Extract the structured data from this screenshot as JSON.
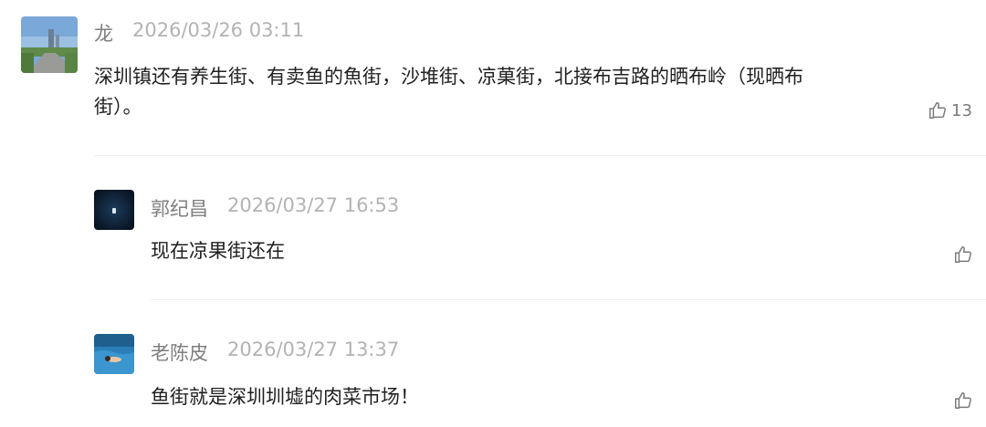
{
  "comments": [
    {
      "name": "龙",
      "time": "2026/03/26 03:11",
      "text": "深圳镇还有养生街、有卖鱼的魚街，沙堆街、凉菓街，北接布吉路的晒布岭（现晒布街）。",
      "likes": "13",
      "avatar": "road-photo-avatar"
    },
    {
      "name": "郭纪昌",
      "time": "2026/03/27 16:53",
      "text": "现在凉果街还在",
      "likes": "",
      "avatar": "dark-blue-avatar"
    },
    {
      "name": "老陈皮",
      "time": "2026/03/27 13:37",
      "text": "鱼街就是深圳圳墟的肉菜市场！",
      "likes": "",
      "avatar": "swimming-pool-avatar"
    }
  ],
  "icons": {
    "like": "thumbs-up-icon"
  },
  "colors": {
    "name": "#7f7f7f",
    "time": "#b3b3b3",
    "text": "#1f1f1f",
    "divider": "#ececec"
  }
}
